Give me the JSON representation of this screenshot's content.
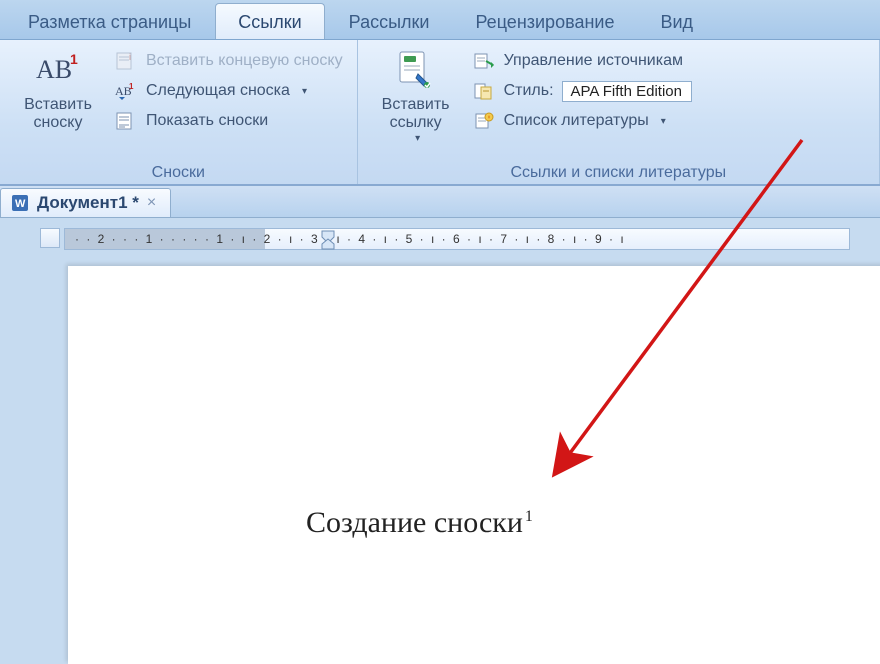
{
  "tabs": {
    "page_layout": "Разметка страницы",
    "references": "Ссылки",
    "mailings": "Рассылки",
    "review": "Рецензирование",
    "view": "Вид"
  },
  "ribbon": {
    "footnotes": {
      "insert_footnote": "Вставить\nсноску",
      "insert_endnote": "Вставить концевую сноску",
      "next_footnote": "Следующая сноска",
      "show_notes": "Показать сноски",
      "group_title": "Сноски"
    },
    "citations": {
      "insert_citation": "Вставить\nссылку",
      "manage_sources": "Управление источникам",
      "style_label": "Стиль:",
      "style_value": "APA Fifth Edition",
      "bibliography": "Список литературы",
      "group_title": "Ссылки и списки литературы"
    }
  },
  "document": {
    "tab_name": "Документ1 *",
    "body_text": "Создание сноски",
    "footnote_mark": "1"
  },
  "ruler": {
    "ticks": "· · 2 · · · 1 ·  ·  ·  ·  · 1 · ı · 2 · ı · 3 · ı · 4 · ı · 5 · ı · 6 · ı · 7 · ı · 8 · ı · 9 · ı"
  }
}
